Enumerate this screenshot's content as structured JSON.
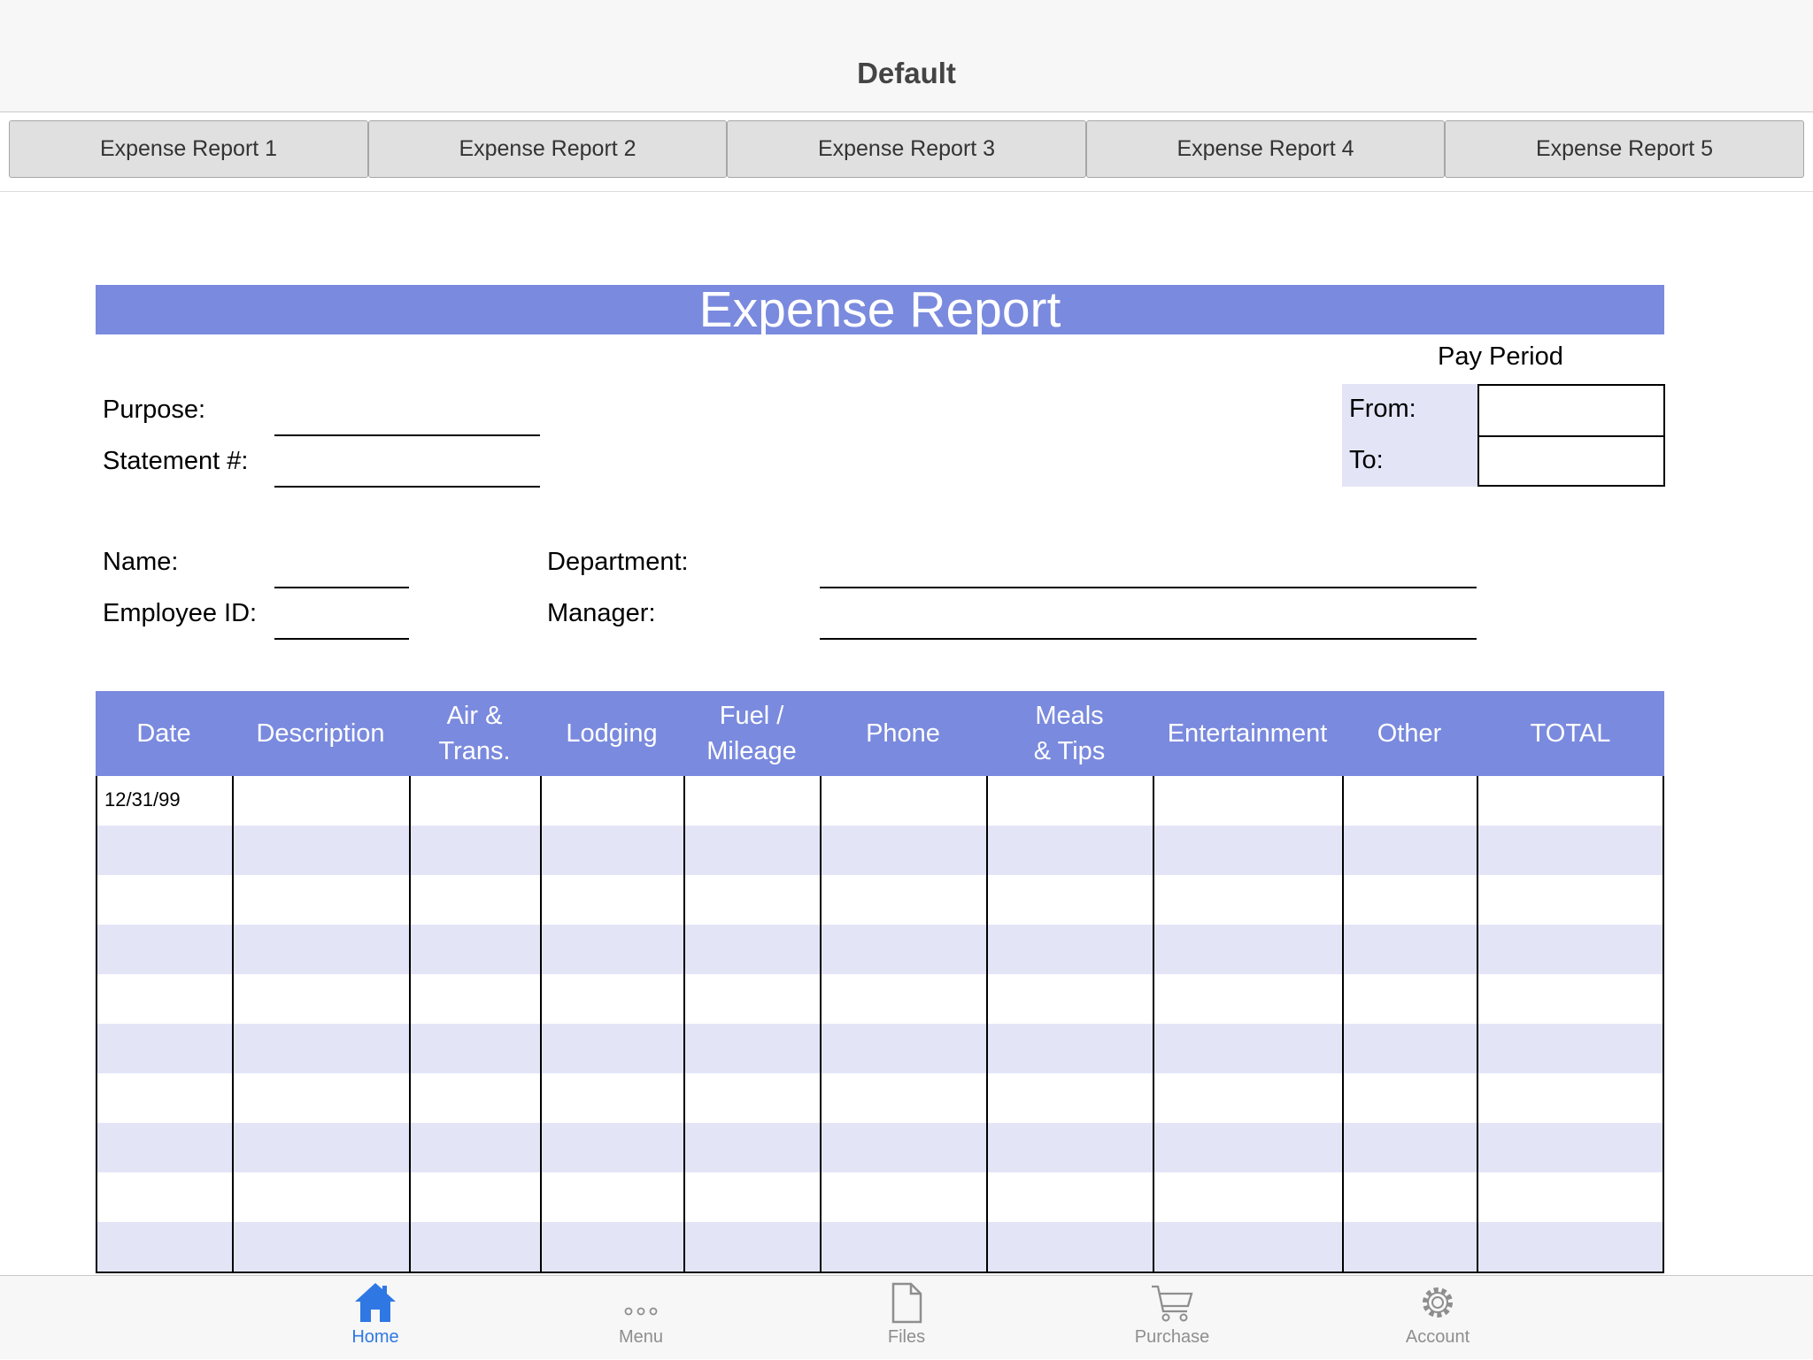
{
  "app": {
    "title": "Default"
  },
  "tabs": [
    {
      "label": "Expense Report 1"
    },
    {
      "label": "Expense Report 2"
    },
    {
      "label": "Expense Report 3"
    },
    {
      "label": "Expense Report 4"
    },
    {
      "label": "Expense Report 5"
    }
  ],
  "report": {
    "title": "Expense Report",
    "pay_period": {
      "heading": "Pay Period",
      "from_label": "From:",
      "to_label": "To:",
      "from_value": "",
      "to_value": ""
    },
    "fields": {
      "purpose_label": "Purpose:",
      "statement_label": "Statement #:",
      "name_label": "Name:",
      "employee_id_label": "Employee ID:",
      "department_label": "Department:",
      "manager_label": "Manager:"
    },
    "table": {
      "columns": [
        "Date",
        "Description",
        "Air &\nTrans.",
        "Lodging",
        "Fuel /\nMileage",
        "Phone",
        "Meals\n& Tips",
        "Entertainment",
        "Other",
        "TOTAL"
      ],
      "rows": [
        [
          "12/31/99",
          "",
          "",
          "",
          "",
          "",
          "",
          "",
          "",
          ""
        ]
      ]
    }
  },
  "toolbar": {
    "items": [
      {
        "label": "Home",
        "icon": "home-icon",
        "active": true
      },
      {
        "label": "Menu",
        "icon": "more-icon",
        "active": false
      },
      {
        "label": "Files",
        "icon": "file-icon",
        "active": false
      },
      {
        "label": "Purchase",
        "icon": "cart-icon",
        "active": false
      },
      {
        "label": "Account",
        "icon": "gear-icon",
        "active": false
      }
    ]
  },
  "colors": {
    "accent": "#7a8ade",
    "stripe": "#e3e5f7",
    "active": "#2f78e4",
    "inactive": "#8e8e8e"
  }
}
